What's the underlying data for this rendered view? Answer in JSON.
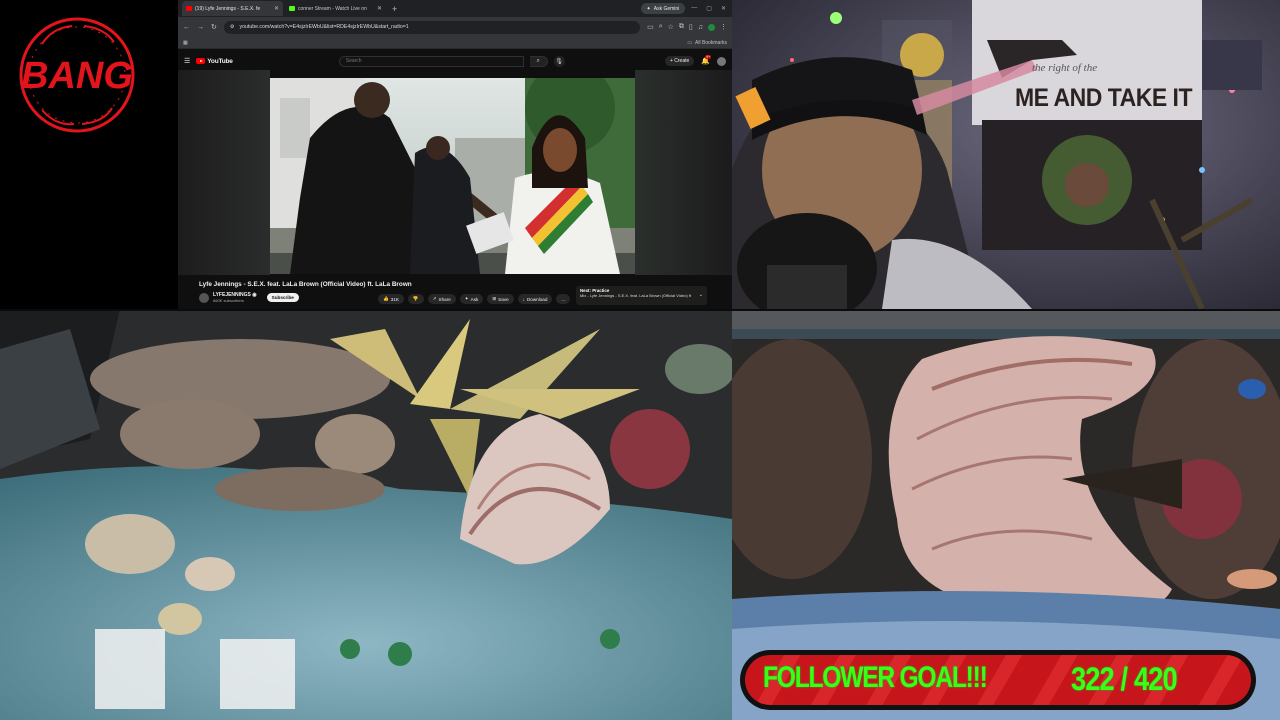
{
  "logo": {
    "text": "BANG",
    "color": "#e3141c"
  },
  "browser": {
    "tabs": [
      {
        "label": "(19) Lyfe Jennings - S.E.X. fe",
        "favicon_color": "#ff0000",
        "active": true
      },
      {
        "label": "conner Stream - Watch Live on",
        "favicon_color": "#53fc18",
        "active": false
      }
    ],
    "new_tab": "+",
    "gemini_label": "Ask Gemini",
    "url": "youtube.com/watch?v=E4sjzIrEWbU&list=RDE4sjzIrEWbU&start_radio=1",
    "all_bookmarks": "All Bookmarks"
  },
  "youtube": {
    "brand": "YouTube",
    "search_placeholder": "Search",
    "create_label": "Create",
    "notif_badge": "9+",
    "video_title": "Lyfe Jennings - S.E.X. feat. LaLa Brown (Official Video) ft. LaLa Brown",
    "channel_name": "LYFEJENNINGS",
    "subscribers": "660K subscribers",
    "subscribe_label": "Subscribe",
    "like_count": "31K",
    "share_label": "Share",
    "ask_label": "Ask",
    "save_label": "Save",
    "download_label": "Download",
    "more_label": "...",
    "next_label": "Next: Practice",
    "next_sub": "Mix - Lyfe Jennings - S.E.X. feat. LaLa Brown (Official Video) ft"
  },
  "webcam": {
    "banner_text": "ME AND TAKE IT",
    "banner_sub": "the right of the"
  },
  "follower_goal": {
    "label": "FOLLOWER GOAL!!!",
    "count_text": "322 / 420",
    "current": 322,
    "target": 420,
    "text_color": "#39ff14",
    "bar_color": "#c7161b"
  }
}
